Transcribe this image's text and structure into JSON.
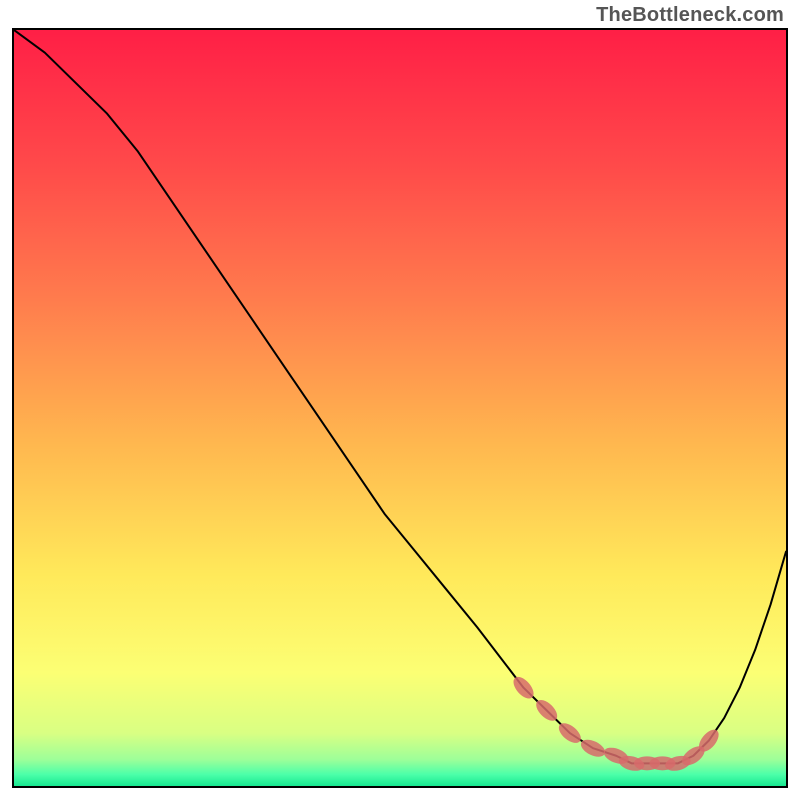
{
  "watermark": "TheBottleneck.com",
  "chart_data": {
    "type": "line",
    "title": "",
    "xlabel": "",
    "ylabel": "",
    "xlim": [
      0,
      100
    ],
    "ylim": [
      0,
      100
    ],
    "x": [
      0,
      4,
      8,
      12,
      16,
      20,
      24,
      28,
      32,
      36,
      40,
      44,
      48,
      52,
      56,
      60,
      63,
      66,
      69,
      72,
      75,
      78,
      80,
      82,
      84,
      86,
      88,
      90,
      92,
      94,
      96,
      98,
      100
    ],
    "values": [
      100,
      97,
      93,
      89,
      84,
      78,
      72,
      66,
      60,
      54,
      48,
      42,
      36,
      31,
      26,
      21,
      17,
      13,
      10,
      7,
      5,
      4,
      3,
      3,
      3,
      3,
      4,
      6,
      9,
      13,
      18,
      24,
      31
    ],
    "dot_x": [
      66,
      69,
      72,
      75,
      78,
      80,
      82,
      84,
      86,
      88,
      90
    ],
    "dot_values": [
      13,
      10,
      7,
      5,
      4,
      3,
      3,
      3,
      3,
      4,
      6
    ],
    "gradient_stops": [
      {
        "offset": 0,
        "color": "#ff1f46"
      },
      {
        "offset": 0.18,
        "color": "#ff4a4a"
      },
      {
        "offset": 0.35,
        "color": "#ff7a4d"
      },
      {
        "offset": 0.55,
        "color": "#ffb84f"
      },
      {
        "offset": 0.72,
        "color": "#ffe95a"
      },
      {
        "offset": 0.85,
        "color": "#fcff74"
      },
      {
        "offset": 0.93,
        "color": "#d9ff83"
      },
      {
        "offset": 0.965,
        "color": "#9dff99"
      },
      {
        "offset": 0.985,
        "color": "#4bffa9"
      },
      {
        "offset": 1.0,
        "color": "#18e891"
      }
    ],
    "dot_color": "#d76b6b",
    "curve_color": "#000000"
  }
}
